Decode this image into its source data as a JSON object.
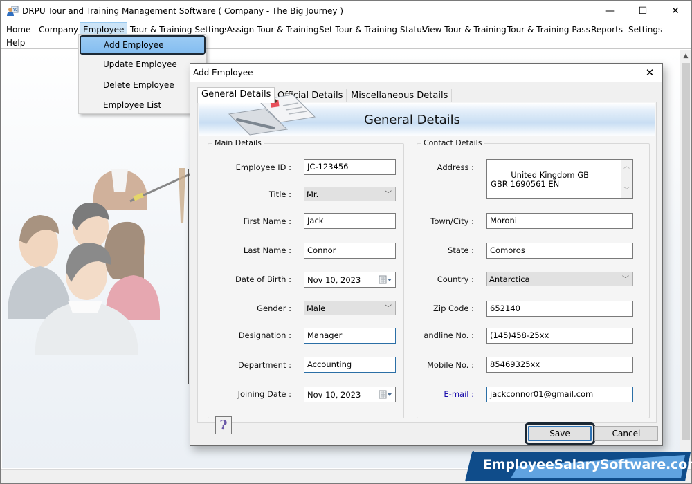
{
  "window": {
    "title": "DRPU Tour and Training Management Software  ( Company - The Big Journey )",
    "controls": {
      "minimize": "—",
      "maximize": "☐",
      "close": "✕"
    }
  },
  "menubar": {
    "items": [
      {
        "label": "Home"
      },
      {
        "label": "Company"
      },
      {
        "label": "Employee",
        "active": true
      },
      {
        "label": "Tour & Training Settings"
      },
      {
        "label": "Assign Tour & Training"
      },
      {
        "label": "Set Tour & Training Status"
      },
      {
        "label": "View Tour & Training"
      },
      {
        "label": "Tour & Training Pass"
      },
      {
        "label": "Reports"
      },
      {
        "label": "Settings"
      },
      {
        "label": "Help"
      }
    ]
  },
  "employee_menu": {
    "items": [
      {
        "label": "Add Employee",
        "highlighted": true
      },
      {
        "label": "Update Employee"
      },
      {
        "label": "Delete Employee"
      },
      {
        "label": "Employee List"
      }
    ]
  },
  "dialog": {
    "title": "Add Employee",
    "close": "✕",
    "tabs": [
      {
        "label": "General Details",
        "active": true
      },
      {
        "label": "Official Details"
      },
      {
        "label": "Miscellaneous Details"
      }
    ],
    "banner_title": "General Details",
    "main_details": {
      "legend": "Main Details",
      "employee_id": {
        "label": "Employee ID :",
        "value": "JC-123456"
      },
      "title": {
        "label": "Title :",
        "value": "Mr."
      },
      "first_name": {
        "label": "First Name :",
        "value": "Jack"
      },
      "last_name": {
        "label": "Last Name :",
        "value": "Connor"
      },
      "date_of_birth": {
        "label": "Date of Birth :",
        "value": "Nov 10, 2023"
      },
      "gender": {
        "label": "Gender :",
        "value": "Male"
      },
      "designation": {
        "label": "Designation :",
        "value": "Manager"
      },
      "department": {
        "label": "Department :",
        "value": "Accounting"
      },
      "joining_date": {
        "label": "Joining Date :",
        "value": "Nov 10, 2023"
      }
    },
    "contact_details": {
      "legend": "Contact Details",
      "address": {
        "label": "Address :",
        "value": "United Kingdom GB\nGBR 1690561 EN"
      },
      "town_city": {
        "label": "Town/City :",
        "value": "Moroni"
      },
      "state": {
        "label": "State :",
        "value": "Comoros"
      },
      "country": {
        "label": "Country :",
        "value": "Antarctica"
      },
      "zip_code": {
        "label": "Zip Code :",
        "value": "652140"
      },
      "landline": {
        "label": "andline No. :",
        "value": "(145)458-25xx"
      },
      "mobile": {
        "label": "Mobile No. :",
        "value": "85469325xx"
      },
      "email": {
        "label": "E-mail :",
        "value": "jackconnor01@gmail.com"
      }
    },
    "help_label": "?",
    "save_label": "Save",
    "cancel_label": "Cancel"
  },
  "watermark": {
    "text": "EmployeeSalarySoftware.com"
  },
  "colors": {
    "menu_highlight": "#9ccbf4",
    "focus_border": "#2b6fa6",
    "watermark_dark": "#0f4c8a",
    "watermark_light": "#6fb3ef",
    "link": "#1a0dab"
  }
}
